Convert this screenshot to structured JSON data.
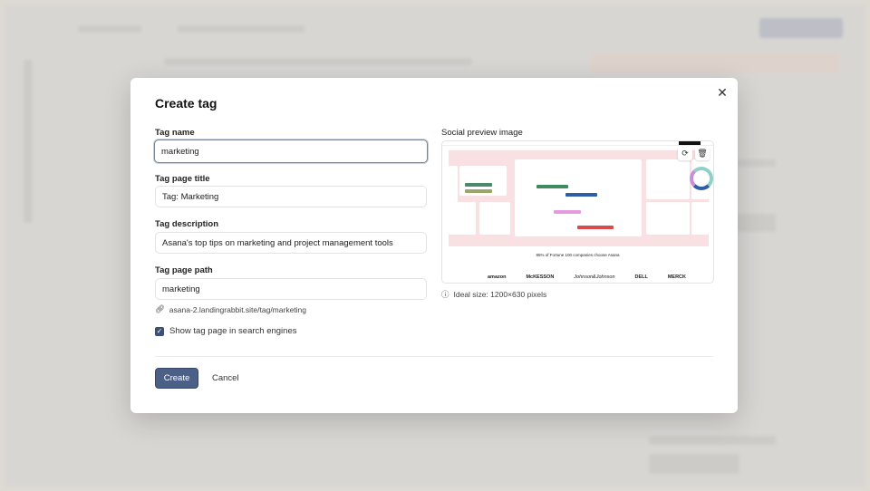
{
  "modal": {
    "title": "Create tag",
    "close_icon": "close-icon",
    "fields": {
      "tag_name": {
        "label": "Tag name",
        "value": "marketing"
      },
      "tag_page_title": {
        "label": "Tag page title",
        "value": "Tag: Marketing"
      },
      "tag_description": {
        "label": "Tag description",
        "value": "Asana's top tips on marketing and project management tools"
      },
      "tag_page_path": {
        "label": "Tag page path",
        "value": "marketing"
      }
    },
    "url_preview": "asana-2.landingrabbit.site/tag/marketing",
    "search_checkbox": {
      "label": "Show tag page in search engines",
      "checked": true
    },
    "create_label": "Create",
    "cancel_label": "Cancel",
    "social_preview": {
      "label": "Social preview image",
      "image_caption": "85% of Fortune 100 companies choose Asana",
      "image_logos": [
        "amazon",
        "McKESSON",
        "Johnson&Johnson",
        "DELL",
        "MERCK"
      ],
      "ideal_size": "Ideal size: 1200×630 pixels"
    }
  },
  "colors": {
    "primary_button": "#4b5f87",
    "preview_bg": "#f9e1e3"
  }
}
